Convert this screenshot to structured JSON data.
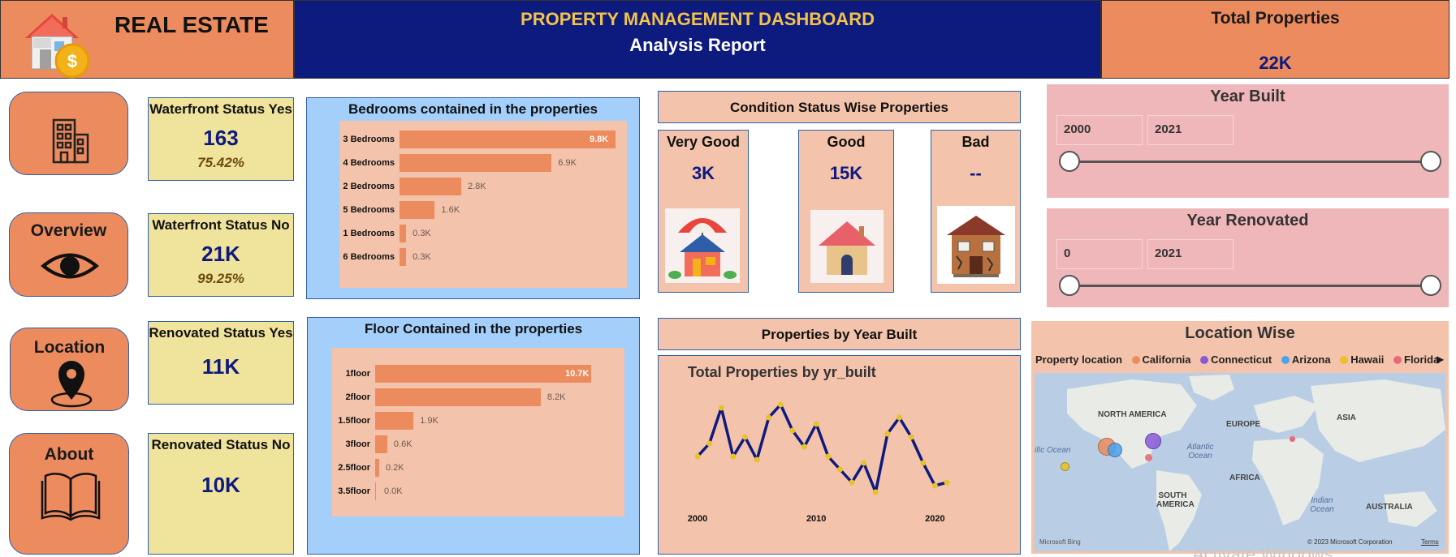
{
  "header": {
    "brand": "REAL ESTATE",
    "title": "PROPERTY MANAGEMENT DASHBOARD",
    "subtitle": "Analysis Report",
    "total_label": "Total Properties",
    "total_value": "22K"
  },
  "nav": {
    "overview": "Overview",
    "location": "Location",
    "about": "About"
  },
  "status_cards": [
    {
      "label": "Waterfront Status Yes",
      "value": "163",
      "pct": "75.42%"
    },
    {
      "label": "Waterfront Status No",
      "value": "21K",
      "pct": "99.25%"
    },
    {
      "label": "Renovated Status Yes",
      "value": "11K"
    },
    {
      "label": "Renovated Status No",
      "value": "10K"
    }
  ],
  "bedrooms": {
    "title": "Bedrooms contained in the properties",
    "items": [
      {
        "label": "3 Bedrooms",
        "value": 9.8,
        "text": "9.8K"
      },
      {
        "label": "4 Bedrooms",
        "value": 6.9,
        "text": "6.9K"
      },
      {
        "label": "2 Bedrooms",
        "value": 2.8,
        "text": "2.8K"
      },
      {
        "label": "5 Bedrooms",
        "value": 1.6,
        "text": "1.6K"
      },
      {
        "label": "1 Bedrooms",
        "value": 0.3,
        "text": "0.3K"
      },
      {
        "label": "6 Bedrooms",
        "value": 0.3,
        "text": "0.3K"
      }
    ]
  },
  "floors": {
    "title": "Floor Contained in the properties",
    "items": [
      {
        "label": "1floor",
        "value": 10.7,
        "text": "10.7K"
      },
      {
        "label": "2floor",
        "value": 8.2,
        "text": "8.2K"
      },
      {
        "label": "1.5floor",
        "value": 1.9,
        "text": "1.9K"
      },
      {
        "label": "3floor",
        "value": 0.6,
        "text": "0.6K"
      },
      {
        "label": "2.5floor",
        "value": 0.2,
        "text": "0.2K"
      },
      {
        "label": "3.5floor",
        "value": 0.0,
        "text": "0.0K"
      }
    ]
  },
  "condition": {
    "title": "Condition Status Wise Properties",
    "items": [
      {
        "label": "Very Good",
        "value": "3K"
      },
      {
        "label": "Good",
        "value": "15K"
      },
      {
        "label": "Bad",
        "value": "--"
      }
    ]
  },
  "year_built_slicer": {
    "title": "Year Built",
    "from": "2000",
    "to": "2021"
  },
  "year_renovated_slicer": {
    "title": "Year Renovated",
    "from": "0",
    "to": "2021"
  },
  "year_built_section": {
    "title": "Properties by Year Built"
  },
  "chart_data": {
    "type": "line",
    "title": "Total Properties by yr_built",
    "xlabel": "",
    "ylabel": "",
    "x": [
      2000,
      2001,
      2002,
      2003,
      2004,
      2005,
      2006,
      2007,
      2008,
      2009,
      2010,
      2011,
      2012,
      2013,
      2014,
      2015,
      2016,
      2017,
      2018,
      2019,
      2020,
      2021
    ],
    "values": [
      390,
      430,
      540,
      390,
      450,
      380,
      510,
      550,
      470,
      420,
      490,
      390,
      350,
      310,
      370,
      280,
      460,
      510,
      450,
      370,
      300,
      310
    ],
    "x_ticks": [
      "2000",
      "2010",
      "2020"
    ],
    "grid": false,
    "line_color": "#0d1a7e",
    "marker_color": "#e8c22a"
  },
  "location": {
    "title": "Location Wise",
    "legend_title": "Property location",
    "legend": [
      {
        "name": "California",
        "color": "#ec8b5e"
      },
      {
        "name": "Connecticut",
        "color": "#8a5ad8"
      },
      {
        "name": "Arizona",
        "color": "#4aa3ee"
      },
      {
        "name": "Hawaii",
        "color": "#e8c22a"
      },
      {
        "name": "Florida",
        "color": "#e86a78"
      }
    ],
    "map_labels": {
      "north_america": "NORTH AMERICA",
      "europe": "EUROPE",
      "asia": "ASIA",
      "africa": "AFRICA",
      "south_america": "SOUTH AMERICA",
      "australia": "AUSTRALIA",
      "pacific": "ific Ocean",
      "atlantic": "Atlantic Ocean",
      "indian": "Indian Ocean"
    },
    "credit": "© 2023 Microsoft Corporation",
    "terms": "Terms",
    "bing": "Microsoft Bing"
  },
  "watermark": "Activate Windows"
}
